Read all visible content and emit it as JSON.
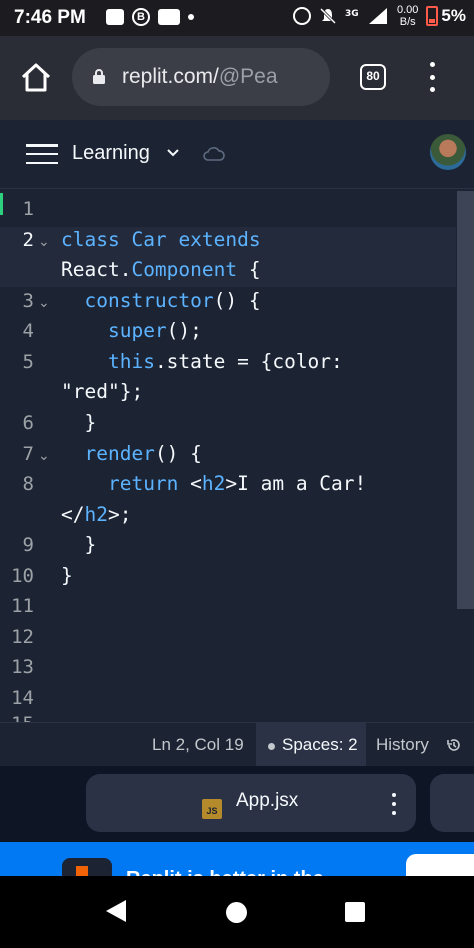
{
  "status_bar": {
    "time": "7:46 PM",
    "net_speed_value": "0.00",
    "net_speed_unit": "B/s",
    "battery": "5%"
  },
  "browser": {
    "url_main": "replit.com/",
    "url_dim": "@Pea",
    "tab_count": "80"
  },
  "header": {
    "project_name": "Learning"
  },
  "editor": {
    "line_numbers": [
      "1",
      "2",
      "",
      "3",
      "4",
      "5",
      "",
      "6",
      "7",
      "8",
      "",
      "9",
      "10",
      "11",
      "12",
      "13",
      "14"
    ]
  },
  "status": {
    "position": "Ln 2, Col 19",
    "spaces": "Spaces: 2",
    "history": "History"
  },
  "file_tab": {
    "badge": "JS",
    "name": "App.jsx"
  },
  "banner": {
    "text": "Replit is better in the"
  },
  "colors": {
    "editor_bg": "#1c2333",
    "keyword": "#5cb3ff",
    "banner": "#0079f2"
  }
}
